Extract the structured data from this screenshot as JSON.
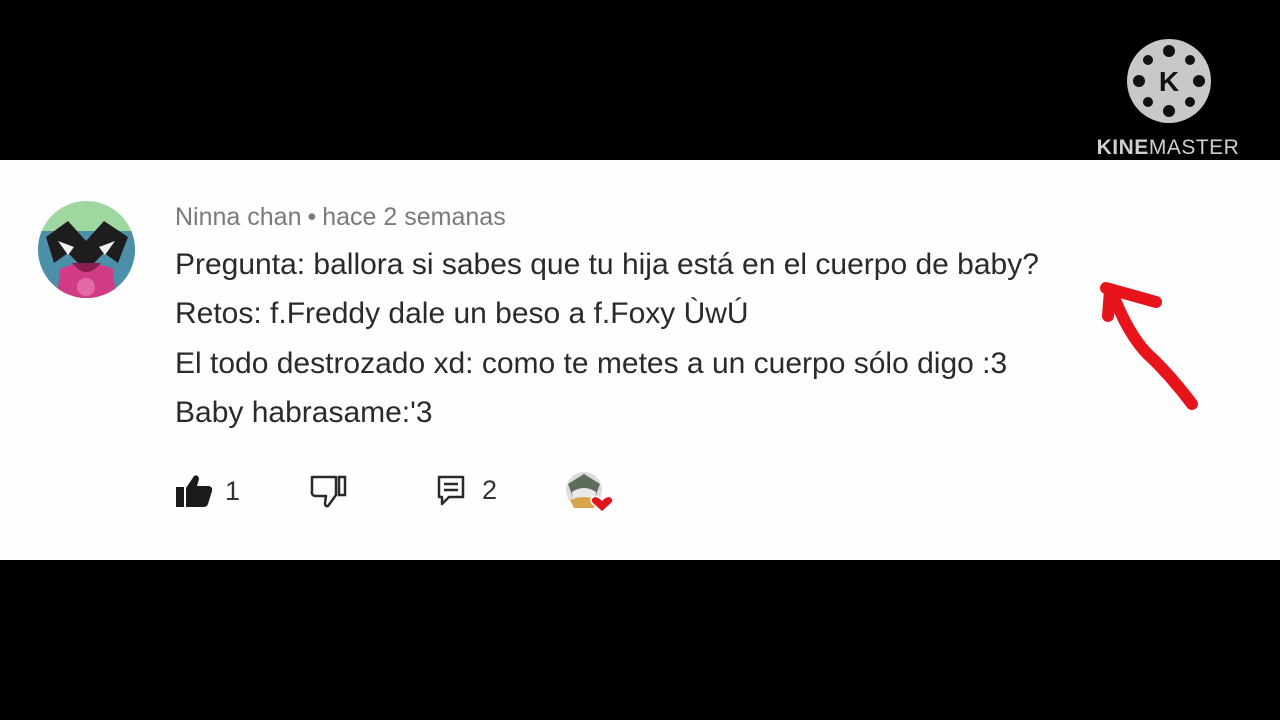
{
  "watermark": {
    "brand_part1": "KINE",
    "brand_part2": "MASTER",
    "logo_letter": "K"
  },
  "comment": {
    "author": "Ninna chan",
    "separator": "•",
    "timestamp": "hace 2 semanas",
    "lines": [
      "Pregunta: ballora si sabes que tu hija está en el cuerpo de baby?",
      "Retos: f.Freddy dale un beso a f.Foxy ÙwÚ",
      "El todo destrozado xd: como te metes a un cuerpo sólo digo :3",
      "Baby habrasame:'3"
    ],
    "actions": {
      "like_count": "1",
      "reply_count": "2"
    }
  },
  "colors": {
    "letterbox": "#000000",
    "panel": "#fefefe",
    "text": "#2a2a2a",
    "meta_text": "#7a7a7a",
    "annotation_arrow": "#e8141b",
    "heart": "#e0151d"
  },
  "icons": [
    "kinemaster-logo-icon",
    "avatar",
    "thumbs-up-icon",
    "thumbs-down-icon",
    "reply-icon",
    "creator-heart-icon",
    "red-arrow-annotation"
  ]
}
